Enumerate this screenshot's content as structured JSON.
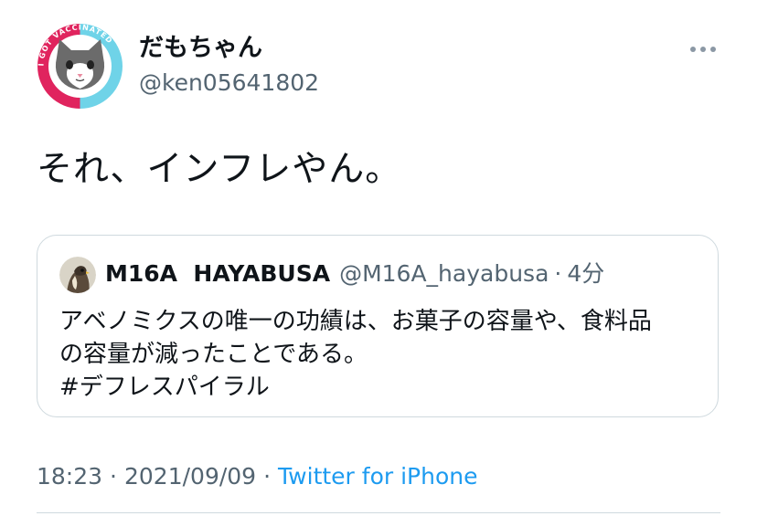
{
  "tweet": {
    "author_name": "だもちゃん",
    "author_handle": "@ken05641802",
    "avatar_ring_text": "I GOT VACCINATED",
    "text": "それ、インフレやん。",
    "quoted": {
      "author_name": "M16A  HAYABUSA",
      "author_handle": "@M16A_hayabusa",
      "separator": "·",
      "time": "4分",
      "text_lines": [
        "アベノミクスの唯一の功績は、お菓子の容量や、食料品",
        "の容量が減ったことである。",
        "#デフレスパイラル"
      ]
    },
    "footer": {
      "time": "18:23",
      "separator": "·",
      "date": "2021/09/09",
      "source": "Twitter for iPhone"
    }
  },
  "icons": {
    "avatar": "cat-avatar-icon",
    "quoted_avatar": "falcon-avatar-icon",
    "more": "more-options-icon"
  },
  "colors": {
    "text": "#0f1419",
    "secondary": "#536471",
    "link": "#1d9bf0",
    "border": "#cfd9de",
    "ring_red": "#e0245e",
    "ring_cyan": "#6fd3e8"
  }
}
